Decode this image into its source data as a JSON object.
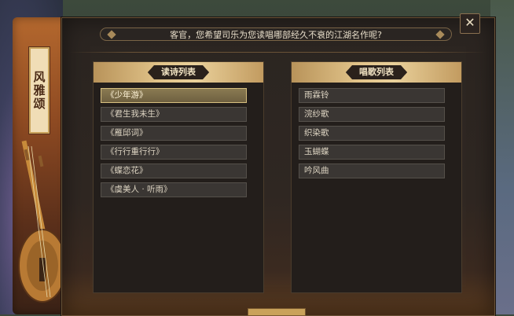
{
  "side_title": "风雅颂",
  "question": "客官，您希望司乐为您读唱哪部经久不衰的江湖名作呢?",
  "close_label": "✕",
  "poem_list": {
    "header": "读诗列表",
    "items": [
      "《少年游》",
      "《君生我未生》",
      "《雁邱词》",
      "《行行重行行》",
      "《蝶恋花》",
      "《虞美人 · 听雨》"
    ],
    "selected_index": 0
  },
  "song_list": {
    "header": "唱歌列表",
    "items": [
      "雨霖铃",
      "浣纱歌",
      "织染歌",
      "玉蝴蝶",
      "吟风曲"
    ]
  },
  "colors": {
    "accent_gold": "#e2c48a",
    "panel_bg": "#2b2521",
    "side_plate": "#b4682e"
  }
}
